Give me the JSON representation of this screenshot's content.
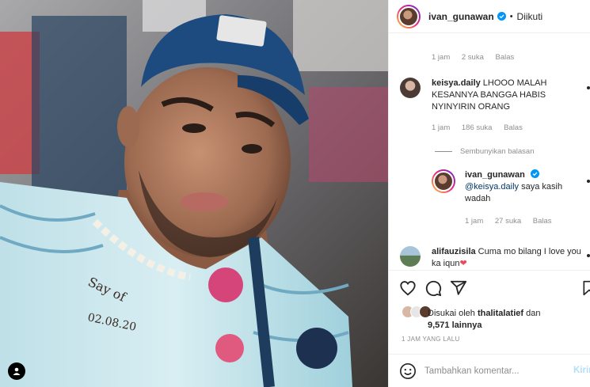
{
  "post_image": {
    "alt": ""
  },
  "header": {
    "username": "ivan_gunawan",
    "separator": "•",
    "follow_state": "Diikuti"
  },
  "comments": [
    {
      "username": "",
      "text": "",
      "meta": {
        "time": "1 jam",
        "likes": "2 suka",
        "reply": "Balas"
      }
    },
    {
      "username": "keisya.daily",
      "text": "LHOOO MALAH KESANNYA BANGGA HABIS NYINYIRIN ORANG",
      "meta": {
        "time": "1 jam",
        "likes": "186 suka",
        "reply": "Balas"
      }
    },
    {
      "username": "ivan_gunawan",
      "mention": "@keisya.daily",
      "text": " saya kasih wadah",
      "meta": {
        "time": "1 jam",
        "likes": "27 suka",
        "reply": "Balas"
      }
    },
    {
      "username": "alifauzisila",
      "text": "Cuma mo bilang I love you ka iqun",
      "emoji": "❤"
    }
  ],
  "hide_replies_label": "Sembunyikan balasan",
  "likes": {
    "prefix": "Disukai oleh",
    "user": "thalitalatief",
    "mid": "dan",
    "count": "9,571 lainnya"
  },
  "timestamp": "1 JAM YANG LALU",
  "comment_box": {
    "placeholder": "Tambahkan komentar...",
    "post_label": "Kirim"
  },
  "colors": {
    "link": "#00376b",
    "muted": "#8e8e8e",
    "verified": "#0095f6",
    "heart": "#ed4956",
    "post_disabled": "#b2dffc"
  },
  "icons": [
    "heart-icon",
    "comment-icon",
    "share-icon",
    "bookmark-icon",
    "emoji-icon",
    "verified-icon",
    "user-tag-icon"
  ]
}
